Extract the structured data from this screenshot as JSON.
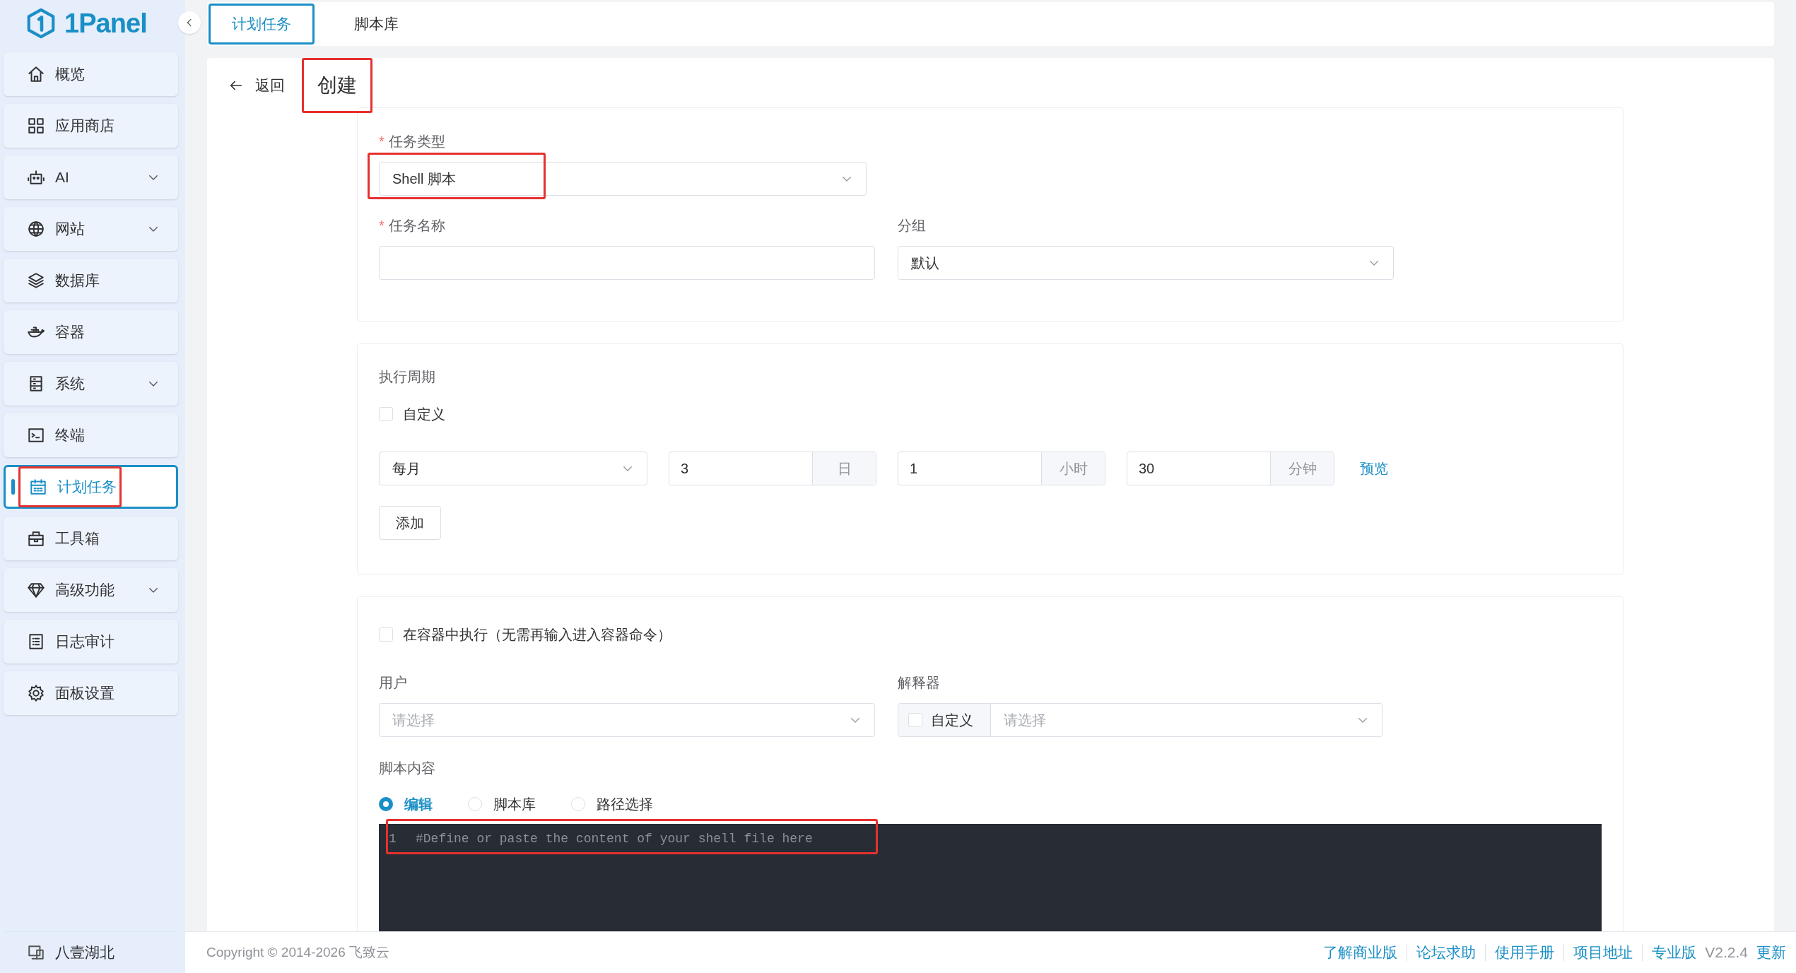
{
  "sidebar": {
    "logo": "1Panel",
    "items": [
      {
        "label": "概览",
        "expandable": false,
        "selected": false,
        "highlighted": false
      },
      {
        "label": "应用商店",
        "expandable": false,
        "selected": false,
        "highlighted": false
      },
      {
        "label": "AI",
        "expandable": true,
        "selected": false,
        "highlighted": false
      },
      {
        "label": "网站",
        "expandable": true,
        "selected": false,
        "highlighted": false
      },
      {
        "label": "数据库",
        "expandable": false,
        "selected": false,
        "highlighted": false
      },
      {
        "label": "容器",
        "expandable": false,
        "selected": false,
        "highlighted": false
      },
      {
        "label": "系统",
        "expandable": true,
        "selected": false,
        "highlighted": false
      },
      {
        "label": "终端",
        "expandable": false,
        "selected": false,
        "highlighted": false
      },
      {
        "label": "计划任务",
        "expandable": false,
        "selected": true,
        "highlighted": true
      },
      {
        "label": "工具箱",
        "expandable": false,
        "selected": false,
        "highlighted": false
      },
      {
        "label": "高级功能",
        "expandable": true,
        "selected": false,
        "highlighted": false
      },
      {
        "label": "日志审计",
        "expandable": false,
        "selected": false,
        "highlighted": false
      },
      {
        "label": "面板设置",
        "expandable": false,
        "selected": false,
        "highlighted": false
      }
    ],
    "node": "八壹湖北"
  },
  "tabs": [
    {
      "label": "计划任务",
      "selected": true
    },
    {
      "label": "脚本库",
      "selected": false
    }
  ],
  "header": {
    "back": "返回",
    "title": "创建",
    "highlighted": true
  },
  "form": {
    "task_type": {
      "label": "任务类型",
      "required_mark": "*",
      "value": "Shell 脚本",
      "highlighted": true
    },
    "task_name": {
      "label": "任务名称",
      "required_mark": "*"
    },
    "group": {
      "label": "分组",
      "value": "默认"
    },
    "schedule": {
      "label": "执行周期",
      "custom": {
        "label": "自定义",
        "checked": false
      },
      "period": "每月",
      "fields": [
        {
          "value": "3",
          "unit": "日"
        },
        {
          "value": "1",
          "unit": "小时"
        },
        {
          "value": "30",
          "unit": "分钟"
        }
      ],
      "preview": "预览",
      "add": "添加"
    },
    "in_container": {
      "label": "在容器中执行（无需再输入进入容器命令）",
      "checked": false
    },
    "user": {
      "label": "用户",
      "placeholder": "请选择"
    },
    "interpreter": {
      "label": "解释器",
      "custom": {
        "label": "自定义",
        "checked": false
      },
      "placeholder": "请选择"
    },
    "script": {
      "label": "脚本内容",
      "options": [
        {
          "label": "编辑",
          "selected": true
        },
        {
          "label": "脚本库",
          "selected": false
        },
        {
          "label": "路径选择",
          "selected": false
        }
      ],
      "lines": [
        {
          "number": "1",
          "text": "#Define or paste the content of your shell file here",
          "highlighted": true
        }
      ]
    }
  },
  "footer": {
    "copyright": "Copyright © 2014-2026 飞致云",
    "links": [
      "了解商业版",
      "论坛求助",
      "使用手册",
      "项目地址",
      "专业版"
    ],
    "version": "V2.2.4",
    "update": "更新"
  }
}
